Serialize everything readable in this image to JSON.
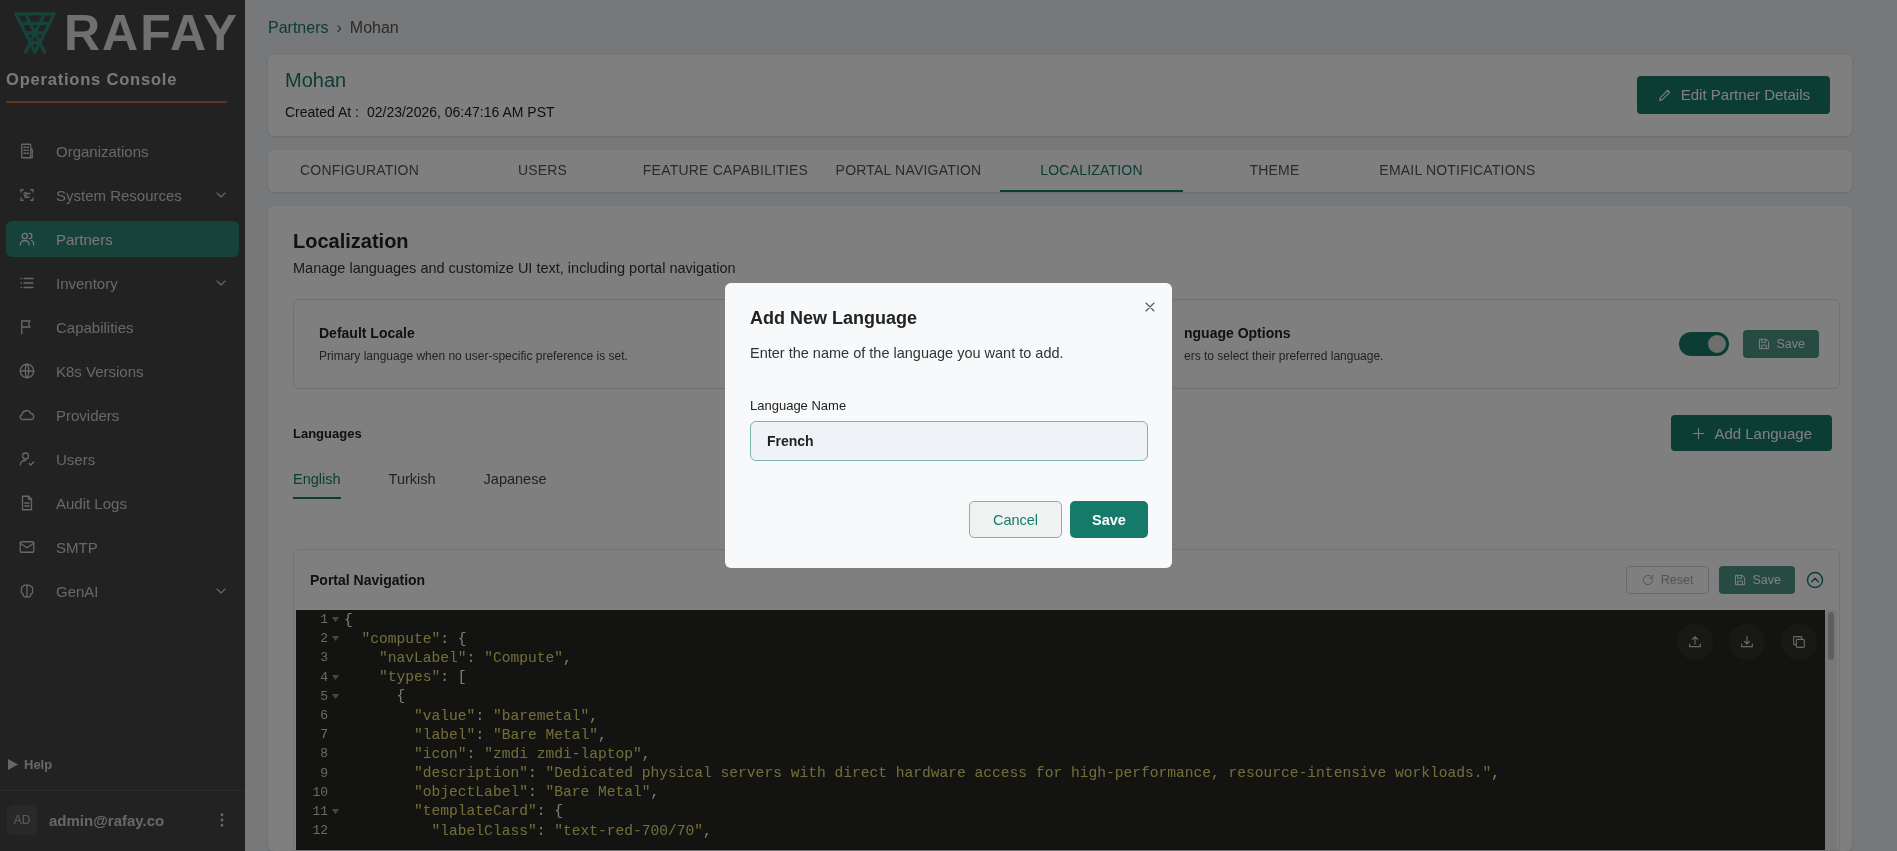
{
  "sidebar": {
    "logo": "RAFAY",
    "subtitle": "Operations Console",
    "items": [
      {
        "label": "Organizations",
        "selected": false,
        "expandable": false
      },
      {
        "label": "System Resources",
        "selected": false,
        "expandable": true
      },
      {
        "label": "Partners",
        "selected": true,
        "expandable": false
      },
      {
        "label": "Inventory",
        "selected": false,
        "expandable": true
      },
      {
        "label": "Capabilities",
        "selected": false,
        "expandable": false
      },
      {
        "label": "K8s Versions",
        "selected": false,
        "expandable": false
      },
      {
        "label": "Providers",
        "selected": false,
        "expandable": false
      },
      {
        "label": "Users",
        "selected": false,
        "expandable": false
      },
      {
        "label": "Audit Logs",
        "selected": false,
        "expandable": false
      },
      {
        "label": "SMTP",
        "selected": false,
        "expandable": false
      },
      {
        "label": "GenAI",
        "selected": false,
        "expandable": true
      }
    ],
    "help": "Help",
    "user": {
      "initials": "AD",
      "email": "admin@rafay.co"
    }
  },
  "breadcrumb": {
    "items": [
      {
        "label": "Partners",
        "link": true
      },
      {
        "label": "Mohan",
        "link": false
      }
    ],
    "separator": "›"
  },
  "partner": {
    "name": "Mohan",
    "created_label": "Created At :",
    "created_value": "02/23/2026, 06:47:16 AM PST",
    "edit_button": "Edit Partner Details"
  },
  "tabs": [
    {
      "label": "CONFIGURATION",
      "selected": false
    },
    {
      "label": "USERS",
      "selected": false
    },
    {
      "label": "FEATURE CAPABILITIES",
      "selected": false
    },
    {
      "label": "PORTAL NAVIGATION",
      "selected": false
    },
    {
      "label": "LOCALIZATION",
      "selected": true
    },
    {
      "label": "THEME",
      "selected": false
    },
    {
      "label": "EMAIL NOTIFICATIONS",
      "selected": false
    }
  ],
  "localization": {
    "title": "Localization",
    "description": "Manage languages and customize UI text, including portal navigation",
    "default_locale": {
      "title": "Default Locale",
      "description": "Primary language when no user-specific preference is set."
    },
    "language_options": {
      "title": "nguage Options",
      "description": "ers to select their preferred language.",
      "on": true,
      "save_button": {
        "label": "Save",
        "disabled": true
      }
    },
    "languages_label": "Languages",
    "add_button": "Add Language",
    "language_tabs": [
      {
        "label": "English",
        "selected": true
      },
      {
        "label": "Turkish",
        "selected": false
      },
      {
        "label": "Japanese",
        "selected": false
      }
    ],
    "portal_navigation": {
      "title": "Portal Navigation",
      "reset_button": {
        "label": "Reset",
        "disabled": true
      },
      "save_button": {
        "label": "Save",
        "disabled": true
      },
      "expanded": true,
      "editor": {
        "lines": [
          {
            "number": "1",
            "text": "{",
            "foldable": true
          },
          {
            "number": "2",
            "text": "  \"compute\": {",
            "foldable": true
          },
          {
            "number": "3",
            "text": "    \"navLabel\": \"Compute\",",
            "foldable": false
          },
          {
            "number": "4",
            "text": "    \"types\": [",
            "foldable": true
          },
          {
            "number": "5",
            "text": "      {",
            "foldable": true
          },
          {
            "number": "6",
            "text": "        \"value\": \"baremetal\",",
            "foldable": false
          },
          {
            "number": "7",
            "text": "        \"label\": \"Bare Metal\",",
            "foldable": false
          },
          {
            "number": "8",
            "text": "        \"icon\": \"zmdi zmdi-laptop\",",
            "foldable": false
          },
          {
            "number": "9",
            "text": "        \"description\": \"Dedicated physical servers with direct hardware access for high-performance, resource-intensive workloads.\",",
            "foldable": false
          },
          {
            "number": "10",
            "text": "        \"objectLabel\": \"Bare Metal\",",
            "foldable": false
          },
          {
            "number": "11",
            "text": "        \"templateCard\": {",
            "foldable": true
          },
          {
            "number": "12",
            "text": "          \"labelClass\": \"text-red-700/70\",",
            "foldable": false
          }
        ]
      }
    }
  },
  "dialog": {
    "title": "Add New Language",
    "description": "Enter the name of the language you want to add.",
    "field_label": "Language Name",
    "value": "French",
    "buttons": [
      {
        "label": "Cancel",
        "kind": "secondary"
      },
      {
        "label": "Save",
        "kind": "primary"
      }
    ]
  }
}
